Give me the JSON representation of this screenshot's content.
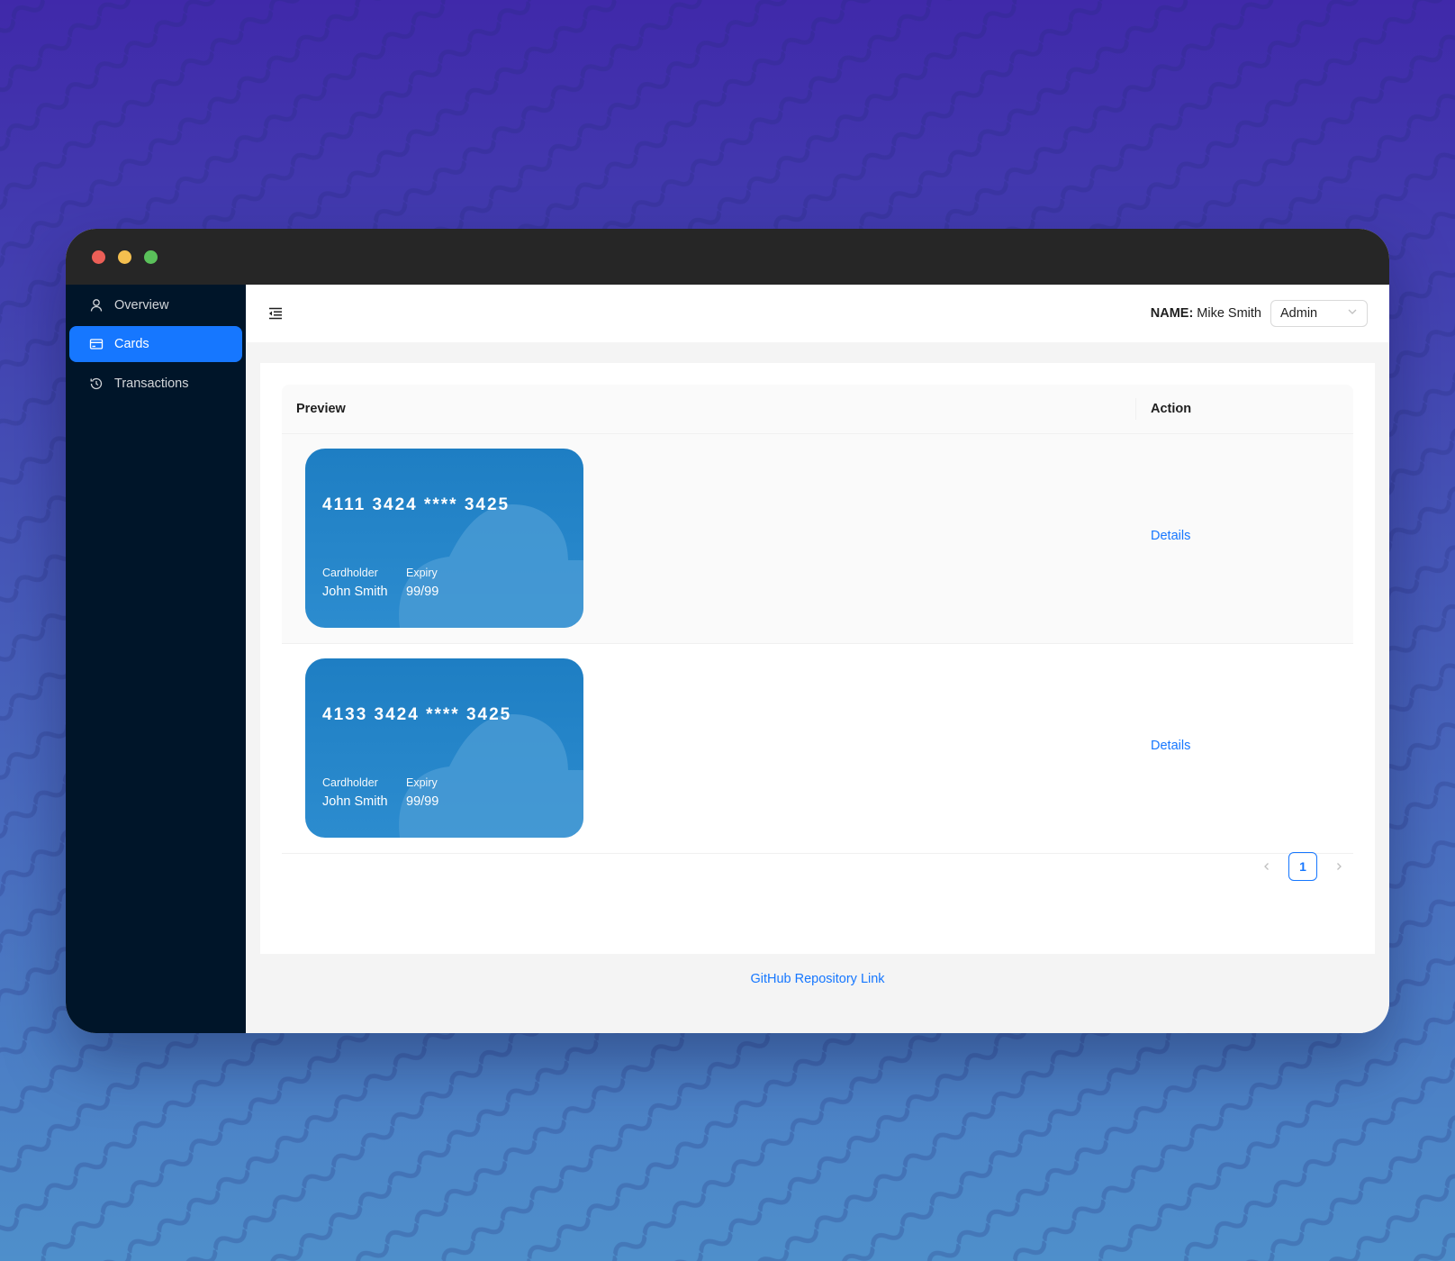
{
  "sidebar": {
    "items": [
      {
        "label": "Overview",
        "icon": "user-icon",
        "active": false
      },
      {
        "label": "Cards",
        "icon": "credit-card-icon",
        "active": true
      },
      {
        "label": "Transactions",
        "icon": "history-icon",
        "active": false
      }
    ]
  },
  "header": {
    "name_label": "NAME:",
    "name_value": "Mike Smith",
    "role_selected": "Admin"
  },
  "table": {
    "columns": [
      "Preview",
      "Action"
    ],
    "rows": [
      {
        "card_number": "4111 3424 **** 3425",
        "cardholder_label": "Cardholder",
        "cardholder": "John Smith",
        "expiry_label": "Expiry",
        "expiry": "99/99",
        "action": "Details"
      },
      {
        "card_number": "4133 3424 **** 3425",
        "cardholder_label": "Cardholder",
        "cardholder": "John Smith",
        "expiry_label": "Expiry",
        "expiry": "99/99",
        "action": "Details"
      }
    ]
  },
  "pagination": {
    "current_page": "1"
  },
  "footer": {
    "link_text": "GitHub Repository Link"
  },
  "colors": {
    "accent": "#1677ff",
    "sidebar_bg": "#001529",
    "card_blue": "#1e7ec3"
  }
}
